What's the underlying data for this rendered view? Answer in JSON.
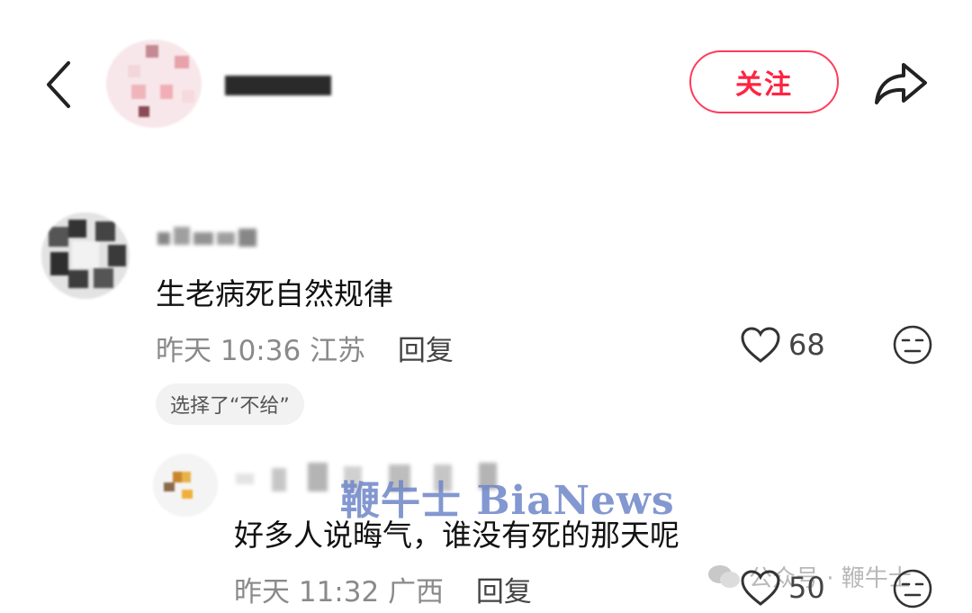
{
  "header": {
    "follow_label": "关注"
  },
  "comments": [
    {
      "text": "生老病死自然规律",
      "time": "昨天 10:36",
      "location": "江苏",
      "reply_label": "回复",
      "likes": "68",
      "tag": "选择了“不给”"
    },
    {
      "text": "好多人说晦气，谁没有死的那天呢",
      "time": "昨天 11:32",
      "location": "广西",
      "reply_label": "回复",
      "likes": "50"
    }
  ],
  "overlay": {
    "watermark": "鞭牛士 BiaNews",
    "wechat_source": "公众号 · 鞭牛士"
  },
  "colors": {
    "accent": "#ff2442",
    "meta_text": "#8a8a8a"
  }
}
